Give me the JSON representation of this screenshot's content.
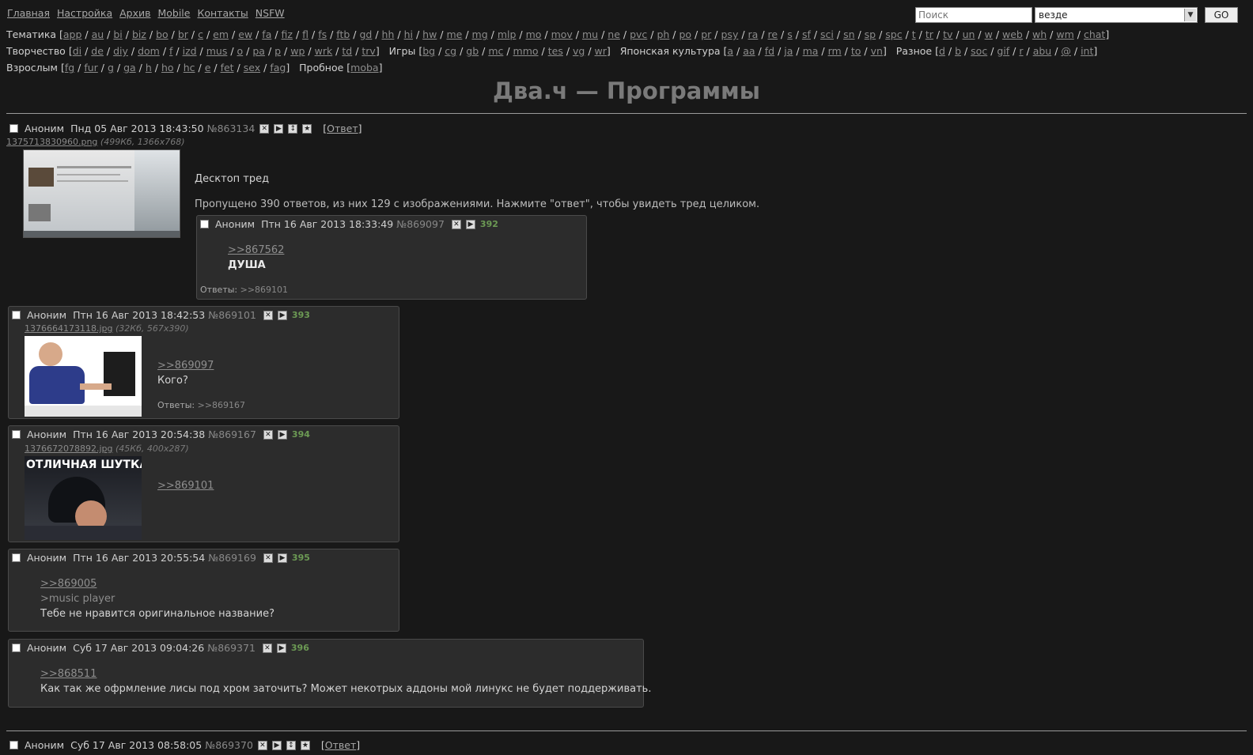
{
  "topnav": [
    "Главная",
    "Настройка",
    "Архив",
    "Mobile",
    "Контакты",
    "NSFW"
  ],
  "search": {
    "placeholder": "Поиск",
    "scope": "везде",
    "go": "GO"
  },
  "boards": {
    "row1_label": "Тематика",
    "row1": [
      "app",
      "au",
      "bi",
      "biz",
      "bo",
      "br",
      "c",
      "em",
      "ew",
      "fa",
      "fiz",
      "fl",
      "fs",
      "ftb",
      "gd",
      "hh",
      "hi",
      "hw",
      "me",
      "mg",
      "mlp",
      "mo",
      "mov",
      "mu",
      "ne",
      "pvc",
      "ph",
      "po",
      "pr",
      "psy",
      "ra",
      "re",
      "s",
      "sf",
      "sci",
      "sn",
      "sp",
      "spc",
      "t",
      "tr",
      "tv",
      "un",
      "w",
      "web",
      "wh",
      "wm",
      "chat"
    ],
    "row2a_label": "Творчество",
    "row2a": [
      "di",
      "de",
      "diy",
      "dom",
      "f",
      "izd",
      "mus",
      "o",
      "pa",
      "p",
      "wp",
      "wrk",
      "td",
      "trv"
    ],
    "row2b_label": "Игры",
    "row2b": [
      "bg",
      "cg",
      "gb",
      "mc",
      "mmo",
      "tes",
      "vg",
      "wr"
    ],
    "row2c_label": "Японская культура",
    "row2c": [
      "a",
      "aa",
      "fd",
      "ja",
      "ma",
      "rm",
      "to",
      "vn"
    ],
    "row2d_label": "Разное",
    "row2d": [
      "d",
      "b",
      "soc",
      "gif",
      "r",
      "abu",
      "@",
      "int"
    ],
    "row3a_label": "Взрослым",
    "row3a": [
      "fg",
      "fur",
      "g",
      "ga",
      "h",
      "ho",
      "hc",
      "e",
      "fet",
      "sex",
      "fag"
    ],
    "row3b_label": "Пробное",
    "row3b": [
      "moba"
    ]
  },
  "page_title": "Два.ч — Программы",
  "op": {
    "name": "Аноним",
    "date": "Пнд 05 Авг 2013 18:43:50",
    "num": "№863134",
    "reply_link": "Ответ",
    "file": "1375713830960.png",
    "file_meta": "(499Кб, 1366x768)",
    "subject": "Десктоп тред",
    "omitted": "Пропущено 390 ответов, из них 129 с изображениями. Нажмите \"ответ\", чтобы увидеть тред целиком."
  },
  "posts": [
    {
      "name": "Аноним",
      "date": "Птн 16 Авг 2013 18:33:49",
      "num": "№869097",
      "count": "392",
      "link": ">>867562",
      "text": "ДУША",
      "answers_label": "Ответы:",
      "answers": ">>869101"
    },
    {
      "name": "Аноним",
      "date": "Птн 16 Авг 2013 18:42:53",
      "num": "№869101",
      "count": "393",
      "file": "1376664173118.jpg",
      "file_meta": "(32Кб, 567x390)",
      "link": ">>869097",
      "text": "Кого?",
      "answers_label": "Ответы:",
      "answers": ">>869167"
    },
    {
      "name": "Аноним",
      "date": "Птн 16 Авг 2013 20:54:38",
      "num": "№869167",
      "count": "394",
      "file": "1376672078892.jpg",
      "file_meta": "(45Кб, 400x287)",
      "link": ">>869101",
      "image_caption": "ОТЛИЧНАЯ ШУТКА"
    },
    {
      "name": "Аноним",
      "date": "Птн 16 Авг 2013 20:55:54",
      "num": "№869169",
      "count": "395",
      "link": ">>869005",
      "greentext": ">music player",
      "text": "Тебе не нравится оригинальное название?"
    },
    {
      "name": "Аноним",
      "date": "Суб 17 Авг 2013 09:04:26",
      "num": "№869371",
      "count": "396",
      "link": ">>868511",
      "text": "Как так же офрмление лисы под хром заточить? Может некотрых аддоны мой линукс не будет поддерживать."
    }
  ],
  "next_op": {
    "name": "Аноним",
    "date": "Суб 17 Авг 2013 08:58:05",
    "num": "№869370",
    "reply_link": "Ответ"
  }
}
